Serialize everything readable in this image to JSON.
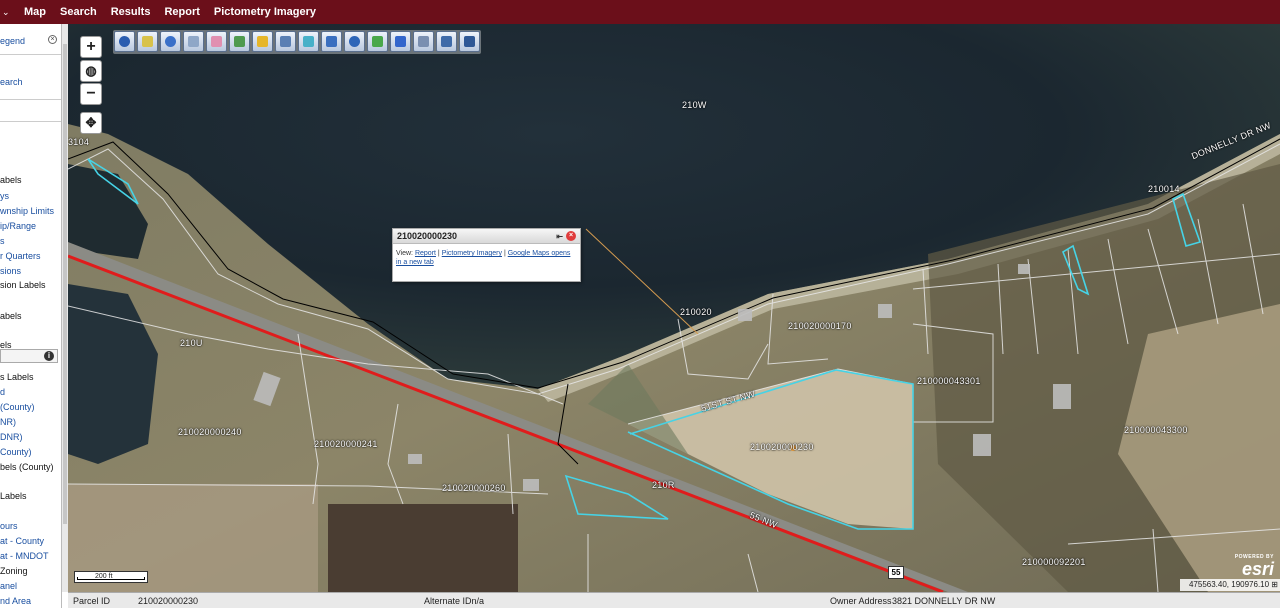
{
  "topbar": {
    "chevron": "⌄",
    "menus": [
      "Map",
      "Search",
      "Results",
      "Report",
      "Pictometry Imagery"
    ]
  },
  "left_panel": {
    "items": [
      {
        "text": "egend",
        "style": "link"
      },
      {
        "text": "earch",
        "style": "link"
      },
      {
        "text": "abels",
        "style": "dark"
      },
      {
        "text": "ys",
        "style": "link"
      },
      {
        "text": "wnship Limits",
        "style": "link"
      },
      {
        "text": "ip/Range",
        "style": "link"
      },
      {
        "text": "s",
        "style": "link"
      },
      {
        "text": "r Quarters",
        "style": "link"
      },
      {
        "text": "sions",
        "style": "link"
      },
      {
        "text": "sion Labels",
        "style": "dark"
      },
      {
        "text": "abels",
        "style": "dark"
      },
      {
        "text": "els",
        "style": "dark"
      },
      {
        "text": "s Labels",
        "style": "dark"
      },
      {
        "text": "d",
        "style": "link"
      },
      {
        "text": "(County)",
        "style": "link"
      },
      {
        "text": "NR)",
        "style": "link"
      },
      {
        "text": "DNR)",
        "style": "link"
      },
      {
        "text": "County)",
        "style": "link"
      },
      {
        "text": "bels (County)",
        "style": "dark"
      },
      {
        "text": "Labels",
        "style": "dark"
      },
      {
        "text": "ours",
        "style": "link"
      },
      {
        "text": "at - County",
        "style": "link"
      },
      {
        "text": "at - MNDOT",
        "style": "link"
      },
      {
        "text": "Zoning",
        "style": "dark"
      },
      {
        "text": "anel",
        "style": "link"
      },
      {
        "text": "nd Area",
        "style": "link"
      }
    ]
  },
  "nav": {
    "zoom_in": "+",
    "globe": "◍",
    "zoom_out": "−",
    "pan": "✥"
  },
  "toolbar": {
    "tools": [
      {
        "icon": "info-icon",
        "color": "#2a5db0"
      },
      {
        "icon": "select-icon",
        "color": "#d8c24a"
      },
      {
        "icon": "zoom-box-icon",
        "color": "#3a70c8"
      },
      {
        "icon": "hand-icon",
        "color": "#8fa7c7"
      },
      {
        "icon": "eraser-icon",
        "color": "#e08fb0"
      },
      {
        "icon": "layers-icon",
        "color": "#4f9a4f"
      },
      {
        "icon": "lightning-icon",
        "color": "#e6b62a"
      },
      {
        "icon": "print-icon",
        "color": "#5a7fb3"
      },
      {
        "icon": "grid-icon",
        "color": "#47b0c8"
      },
      {
        "icon": "measure-icon",
        "color": "#3a6fbf"
      },
      {
        "icon": "magnify-icon",
        "color": "#2e66b8"
      },
      {
        "icon": "pencil-icon",
        "color": "#4aa84a"
      },
      {
        "icon": "identify-icon",
        "color": "#3366cc"
      },
      {
        "icon": "bookmark-icon",
        "color": "#7a8fb0"
      },
      {
        "icon": "export-icon",
        "color": "#3f6ba8"
      },
      {
        "icon": "save-icon",
        "color": "#2f5896"
      }
    ]
  },
  "popup": {
    "title": "210020000230",
    "pin": "⇤",
    "close": "×",
    "view_prefix": "View:",
    "report_link": "Report",
    "sep1": "|",
    "pictometry_link": "Pictometry Imagery",
    "sep2": "|",
    "google_link": "Google Maps opens in a new tab"
  },
  "map_labels": [
    {
      "id": "lake",
      "text": "210W"
    },
    {
      "id": "donnelly",
      "text": "DONNELLY DR NW"
    },
    {
      "id": "p3104",
      "text": "3104"
    },
    {
      "id": "p210014",
      "text": "210014"
    },
    {
      "id": "p210020",
      "text": "210020"
    },
    {
      "id": "p170",
      "text": "210020000170"
    },
    {
      "id": "p210u",
      "text": "210U"
    },
    {
      "id": "p43301",
      "text": "210000043301"
    },
    {
      "id": "st51",
      "text": "51ST ST NW"
    },
    {
      "id": "p43300",
      "text": "210000043300"
    },
    {
      "id": "p230",
      "text": "210020000230"
    },
    {
      "id": "p240",
      "text": "210020000240"
    },
    {
      "id": "p241",
      "text": "210020000241"
    },
    {
      "id": "p260",
      "text": "210020000260"
    },
    {
      "id": "p210r",
      "text": "210R"
    },
    {
      "id": "hw55",
      "text": "55   NW"
    },
    {
      "id": "p92201",
      "text": "210000092201"
    }
  ],
  "road_shield": "55",
  "scalebar": {
    "label": "200 ft"
  },
  "esri": {
    "powered_by": "POWERED BY",
    "logo": "esri"
  },
  "coords": "475563.40, 190976.10 ⊞",
  "bottombar": {
    "parcel_id_label": "Parcel ID",
    "parcel_id_value": "210020000230",
    "alt_id_label": "Alternate IDn/a",
    "owner_label": "Owner Address",
    "owner_value": "3821 DONNELLY DR NW"
  }
}
